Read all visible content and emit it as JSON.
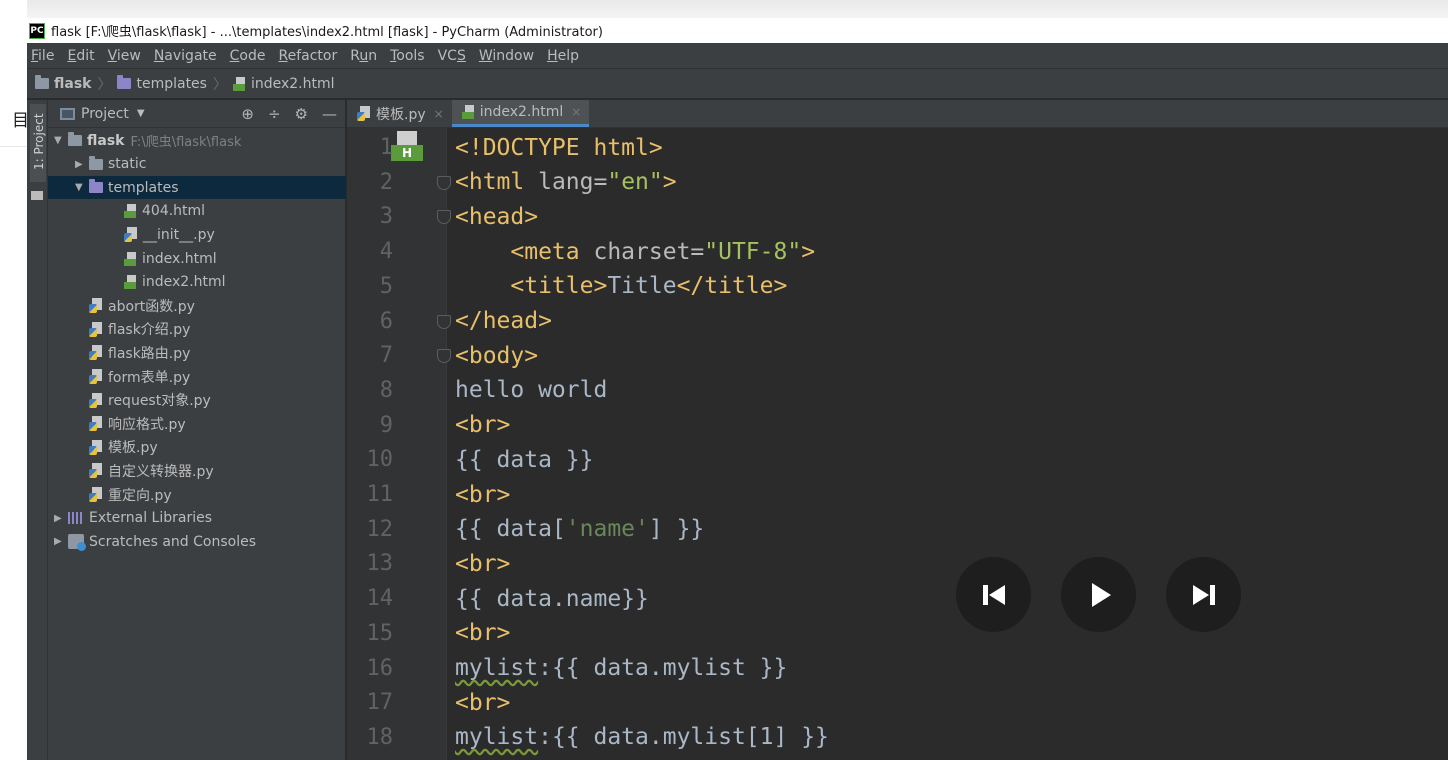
{
  "outer": {
    "glyph": "目"
  },
  "window": {
    "title": "flask [F:\\爬虫\\flask\\flask] - ...\\templates\\index2.html [flask] - PyCharm (Administrator)",
    "logo": "PC"
  },
  "menu": [
    {
      "mnemonic": "F",
      "rest": "ile"
    },
    {
      "mnemonic": "E",
      "rest": "dit"
    },
    {
      "mnemonic": "V",
      "rest": "iew"
    },
    {
      "mnemonic": "N",
      "rest": "avigate"
    },
    {
      "mnemonic": "C",
      "rest": "ode"
    },
    {
      "mnemonic": "R",
      "rest": "efactor"
    },
    {
      "pre": "R",
      "mnemonic": "u",
      "rest": "n"
    },
    {
      "mnemonic": "T",
      "rest": "ools"
    },
    {
      "pre": "VC",
      "mnemonic": "S",
      "rest": ""
    },
    {
      "mnemonic": "W",
      "rest": "indow"
    },
    {
      "mnemonic": "H",
      "rest": "elp"
    }
  ],
  "breadcrumb": [
    "flask",
    "templates",
    "index2.html"
  ],
  "toolstrip": {
    "project_label": "1: Project"
  },
  "project_panel": {
    "title": "Project",
    "tools": [
      "target-icon",
      "collapse-icon",
      "gear-icon",
      "minimize-icon"
    ],
    "tree": [
      {
        "label": "flask",
        "path": "F:\\爬虫\\flask\\flask",
        "kind": "folder",
        "depth": 0,
        "arrow": "▼",
        "bold": true
      },
      {
        "label": "static",
        "kind": "folder",
        "depth": 1,
        "arrow": "▶"
      },
      {
        "label": "templates",
        "kind": "folder-purple",
        "depth": 1,
        "arrow": "▼",
        "selected": true
      },
      {
        "label": "404.html",
        "kind": "html",
        "depth": 2
      },
      {
        "label": "__init__.py",
        "kind": "py",
        "depth": 2
      },
      {
        "label": "index.html",
        "kind": "html",
        "depth": 2
      },
      {
        "label": "index2.html",
        "kind": "html",
        "depth": 2
      },
      {
        "label": "abort函数.py",
        "kind": "py",
        "depth": 1
      },
      {
        "label": "flask介绍.py",
        "kind": "py",
        "depth": 1
      },
      {
        "label": "flask路由.py",
        "kind": "py",
        "depth": 1
      },
      {
        "label": "form表单.py",
        "kind": "py",
        "depth": 1
      },
      {
        "label": "request对象.py",
        "kind": "py",
        "depth": 1
      },
      {
        "label": "响应格式.py",
        "kind": "py",
        "depth": 1
      },
      {
        "label": "模板.py",
        "kind": "py",
        "depth": 1
      },
      {
        "label": "自定义转换器.py",
        "kind": "py",
        "depth": 1
      },
      {
        "label": "重定向.py",
        "kind": "py",
        "depth": 1
      },
      {
        "label": "External Libraries",
        "kind": "libs",
        "depth": 0,
        "arrow": "▶"
      },
      {
        "label": "Scratches and Consoles",
        "kind": "scratch",
        "depth": 0,
        "arrow": "▶"
      }
    ]
  },
  "tabs": [
    {
      "label": "模板.py",
      "kind": "py",
      "active": false,
      "close": "×"
    },
    {
      "label": "index2.html",
      "kind": "html",
      "active": true,
      "close": "×"
    }
  ],
  "editor": {
    "badge": "H",
    "lines": [
      {
        "n": "1",
        "fold": false,
        "segs": [
          [
            "tag",
            "<!DOCTYPE html>"
          ]
        ]
      },
      {
        "n": "2",
        "fold": true,
        "segs": [
          [
            "tag",
            "<html "
          ],
          [
            "attr",
            "lang="
          ],
          [
            "str",
            "\"en\""
          ],
          [
            "tag",
            ">"
          ]
        ]
      },
      {
        "n": "3",
        "fold": true,
        "segs": [
          [
            "tag",
            "<head>"
          ]
        ]
      },
      {
        "n": "4",
        "fold": false,
        "segs": [
          [
            "txt",
            "    "
          ],
          [
            "tag",
            "<meta "
          ],
          [
            "attr",
            "charset="
          ],
          [
            "str",
            "\"UTF-8\""
          ],
          [
            "tag",
            ">"
          ]
        ]
      },
      {
        "n": "5",
        "fold": false,
        "segs": [
          [
            "txt",
            "    "
          ],
          [
            "tag",
            "<title>"
          ],
          [
            "txt",
            "Title"
          ],
          [
            "tag",
            "</title>"
          ]
        ]
      },
      {
        "n": "6",
        "fold": true,
        "segs": [
          [
            "tag",
            "</head>"
          ]
        ]
      },
      {
        "n": "7",
        "fold": true,
        "segs": [
          [
            "tag",
            "<body>"
          ]
        ]
      },
      {
        "n": "8",
        "fold": false,
        "segs": [
          [
            "txt",
            "hello world"
          ]
        ]
      },
      {
        "n": "9",
        "fold": false,
        "segs": [
          [
            "tag",
            "<br>"
          ]
        ]
      },
      {
        "n": "10",
        "fold": false,
        "segs": [
          [
            "txt",
            "{{ data }}"
          ]
        ]
      },
      {
        "n": "11",
        "fold": false,
        "segs": [
          [
            "tag",
            "<br>"
          ]
        ]
      },
      {
        "n": "12",
        "fold": false,
        "segs": [
          [
            "txt",
            "{{ data["
          ],
          [
            "strq",
            "'name'"
          ],
          [
            "txt",
            "] }}"
          ]
        ]
      },
      {
        "n": "13",
        "fold": false,
        "segs": [
          [
            "tag",
            "<br>"
          ]
        ]
      },
      {
        "n": "14",
        "fold": false,
        "segs": [
          [
            "txt",
            "{{ data.name}}"
          ]
        ]
      },
      {
        "n": "15",
        "fold": false,
        "segs": [
          [
            "tag",
            "<br>"
          ]
        ]
      },
      {
        "n": "16",
        "fold": false,
        "segs": [
          [
            "warn",
            "mylist"
          ],
          [
            "txt",
            ":{{ data.mylist }}"
          ]
        ]
      },
      {
        "n": "17",
        "fold": false,
        "segs": [
          [
            "tag",
            "<br>"
          ]
        ]
      },
      {
        "n": "18",
        "fold": false,
        "segs": [
          [
            "warn",
            "mylist"
          ],
          [
            "txt",
            ":{{ data.mylist[1] }}"
          ]
        ]
      }
    ]
  },
  "media_controls": [
    "previous-icon",
    "play-icon",
    "next-icon"
  ],
  "colors": {
    "editor_bg": "#2b2b2b",
    "panel_bg": "#3c3f41",
    "tag": "#e8bf6a",
    "string": "#a5c261",
    "selection": "#0d293e",
    "active_tab_underline": "#4a88c7"
  }
}
